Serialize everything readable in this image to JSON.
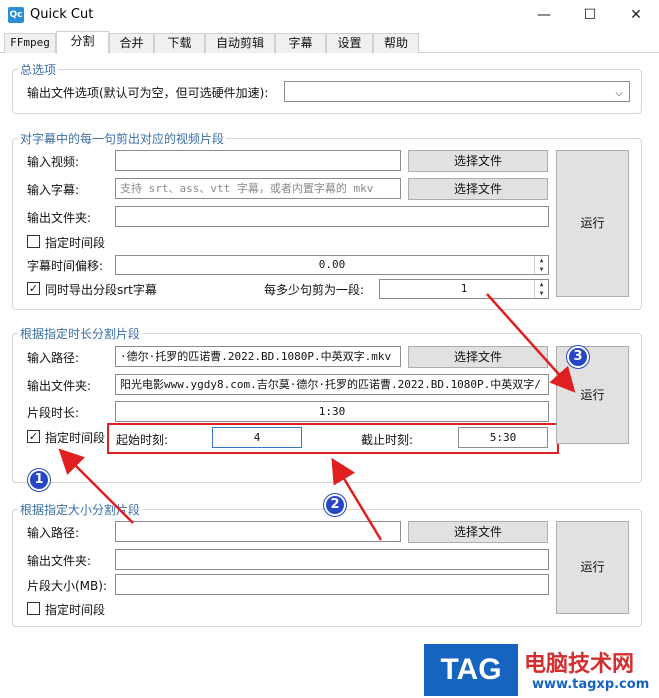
{
  "window": {
    "title": "Quick Cut",
    "icon_text": "Qc",
    "minimize": "—",
    "maximize": "☐",
    "close": "✕"
  },
  "tabs": [
    "FFmpeg",
    "分割",
    "合并",
    "下载",
    "自动剪辑",
    "字幕",
    "设置",
    "帮助"
  ],
  "general": {
    "title": "总选项",
    "output_options_label": "输出文件选项(默认可为空，但可选硬件加速):",
    "output_options_value": ""
  },
  "subtitle_split": {
    "title": "对字幕中的每一句剪出对应的视频片段",
    "input_video_label": "输入视频:",
    "input_video_value": "",
    "input_subtitle_label": "输入字幕:",
    "input_subtitle_placeholder": "支持 srt、ass、vtt 字幕，或者内置字幕的 mkv",
    "output_folder_label": "输出文件夹:",
    "output_folder_value": "",
    "choose_file_1": "选择文件",
    "choose_file_2": "选择文件",
    "time_range_label": "指定时间段",
    "offset_label": "字幕时间偏移:",
    "offset_value": "0.00",
    "export_srt_label": "同时导出分段srt字幕",
    "every_n_label": "每多少句剪为一段:",
    "every_n_value": "1",
    "run": "运行"
  },
  "duration_split": {
    "title": "根据指定时长分割片段",
    "input_path_label": "输入路径:",
    "input_path_value": "·德尔·托罗的匹诺曹.2022.BD.1080P.中英双字.mkv",
    "output_folder_label": "输出文件夹:",
    "output_folder_value": "阳光电影www.ygdy8.com.吉尔莫·德尔·托罗的匹诺曹.2022.BD.1080P.中英双字/",
    "segment_duration_label": "片段时长:",
    "segment_duration_value": "1:30",
    "time_range_label": "指定时间段",
    "start_label": "起始时刻:",
    "start_value": "4",
    "end_label": "截止时刻:",
    "end_value": "5:30",
    "choose_file": "选择文件",
    "run": "运行"
  },
  "size_split": {
    "title": "根据指定大小分割片段",
    "input_path_label": "输入路径:",
    "input_path_value": "",
    "output_folder_label": "输出文件夹:",
    "output_folder_value": "",
    "segment_size_label": "片段大小(MB):",
    "segment_size_value": "",
    "time_range_label": "指定时间段",
    "choose_file": "选择文件",
    "run": "运行"
  },
  "annotations": {
    "badge_1": "1",
    "badge_2": "2",
    "badge_3": "3",
    "annotation_color": "#e02020",
    "badge_color": "#2646c8"
  },
  "watermark": {
    "tag": "TAG",
    "site_name": "电脑技术网",
    "url": "www.tagxp.com"
  },
  "colors": {
    "group_title": "#3a6ea8",
    "button_bg": "#e1e1e1"
  }
}
